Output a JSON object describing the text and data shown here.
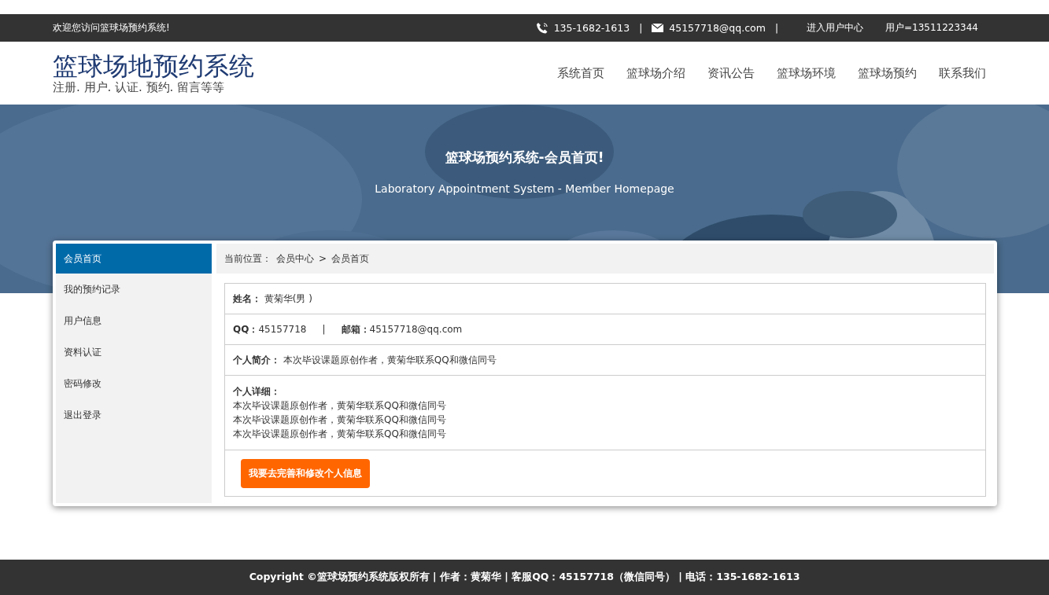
{
  "top_bar": {
    "welcome": "欢迎您访问篮球场预约系统!",
    "phone": "135-1682-1613",
    "separator_1": "|",
    "email": "45157718@qq.com",
    "separator_2": "|",
    "user_center": "进入用户中心",
    "user": "用户=13511223344"
  },
  "header": {
    "title": "篮球场地预约系统",
    "subtitle": "注册. 用户. 认证. 预约. 留言等等",
    "nav": [
      {
        "label": "系统首页"
      },
      {
        "label": "篮球场介绍"
      },
      {
        "label": "资讯公告"
      },
      {
        "label": "篮球场环境"
      },
      {
        "label": "篮球场预约"
      },
      {
        "label": "联系我们"
      }
    ]
  },
  "banner": {
    "kind": "picture",
    "title": "篮球场预约系统-会员首页!",
    "subtitle": "Laboratory Appointment System - Member Homepage"
  },
  "sidebar": {
    "items": [
      {
        "label": "会员首页",
        "selected": true
      },
      {
        "label": "我的预约记录",
        "selected": false
      },
      {
        "label": "用户信息",
        "selected": false
      },
      {
        "label": "资料认证",
        "selected": false
      },
      {
        "label": "密码修改",
        "selected": false
      },
      {
        "label": "退出登录",
        "selected": false
      }
    ]
  },
  "breadcrumb": {
    "label": "当前位置：",
    "path": [
      "会员中心",
      "会员首页"
    ],
    "separator": ">"
  },
  "profile": {
    "name": "**姓名：** 黄菊华(男 )",
    "qq": "**QQ：**45157718",
    "separator": "|",
    "email": "**邮箱：**45157718@qq.com",
    "intro": "**个人简介：** 本次毕设课题原创作者，黄菊华联系QQ和微信同号",
    "detail_label": "个人详细：",
    "detail_lines": [
      "本次毕设课题原创作者，黄菊华联系QQ和微信同号",
      "本次毕设课题原创作者，黄菊华联系QQ和微信同号",
      "本次毕设课题原创作者，黄菊华联系QQ和微信同号"
    ],
    "button": "我要去完善和修改个人信息"
  },
  "footer": {
    "text": "Copyright ©篮球场预约系统版权所有 | 作者：黄菊华 | 客服QQ：45157718（微信同号） | 电话：135-1682-1613"
  }
}
